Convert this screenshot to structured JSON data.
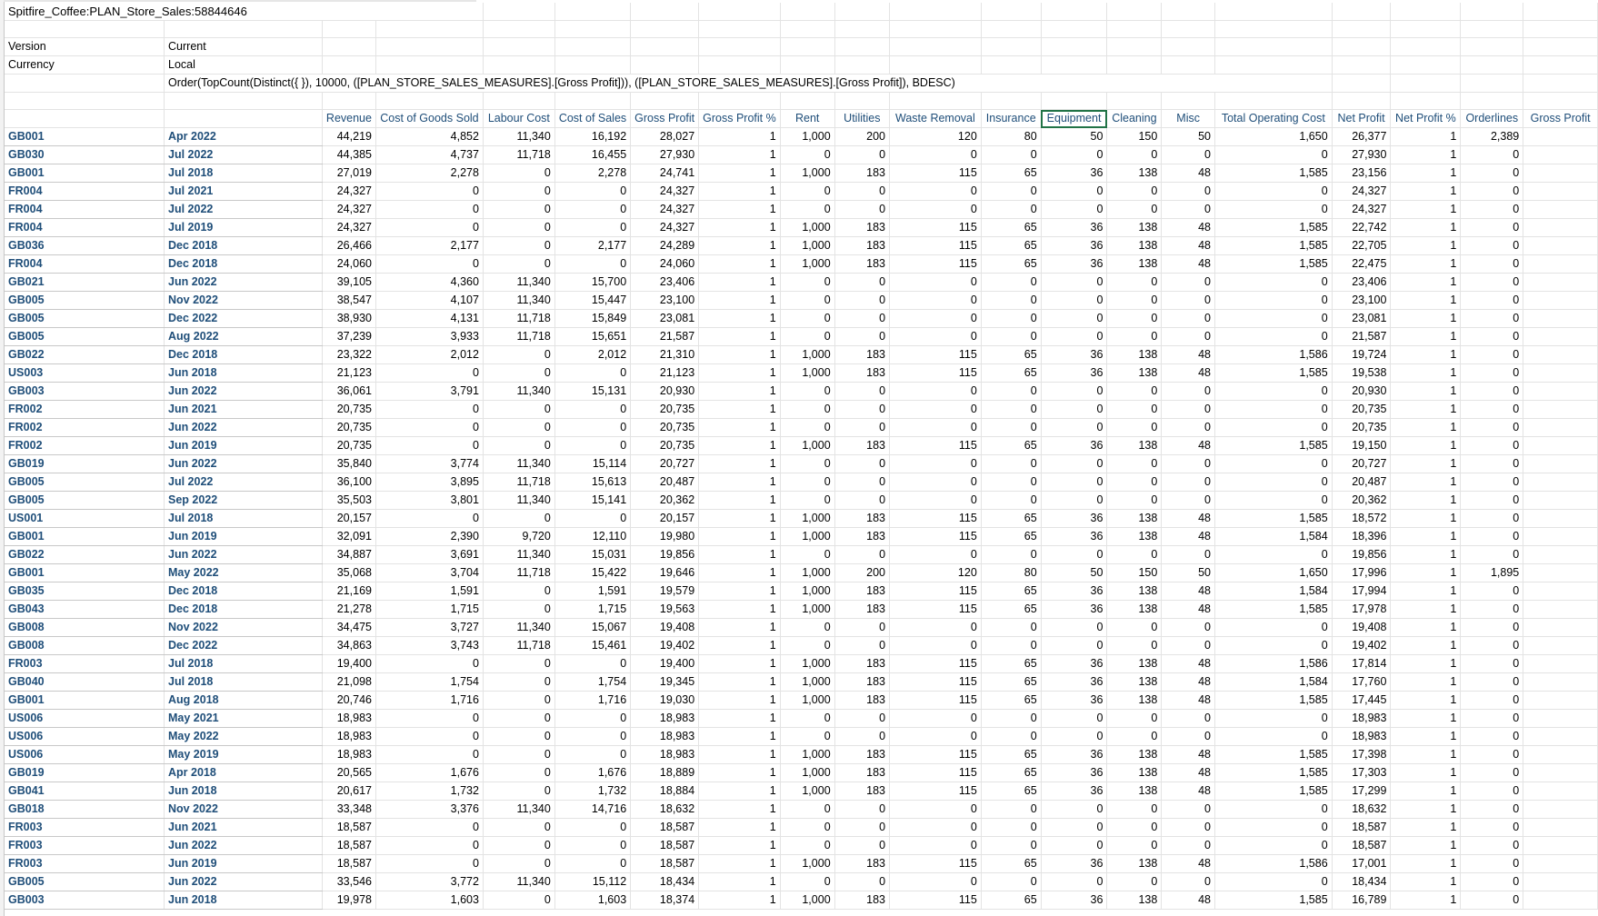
{
  "sheet": {
    "title": "Spitfire_Coffee:PLAN_Store_Sales:58844646",
    "version_label": "Version",
    "version_value": "Current",
    "currency_label": "Currency",
    "currency_value": "Local",
    "formula": "Order(TopCount(Distinct({  }), 10000, ([PLAN_STORE_SALES_MEASURES].[Gross Profit])), ([PLAN_STORE_SALES_MEASURES].[Gross Profit]), BDESC)"
  },
  "columns": [
    "Revenue",
    "Cost of Goods Sold",
    "Labour Cost",
    "Cost of Sales",
    "Gross Profit",
    "Gross Profit %",
    "Rent",
    "Utilities",
    "Waste Removal",
    "Insurance",
    "Equipment",
    "Cleaning",
    "Misc",
    "Total Operating Cost",
    "Net Profit",
    "Net Profit %",
    "Orderlines",
    "Gross Profit"
  ],
  "rows": [
    [
      "GB001",
      "Apr 2022",
      "44,219",
      "4,852",
      "11,340",
      "16,192",
      "28,027",
      "1",
      "1,000",
      "200",
      "120",
      "80",
      "50",
      "150",
      "50",
      "1,650",
      "26,377",
      "1",
      "2,389"
    ],
    [
      "GB030",
      "Jul 2022",
      "44,385",
      "4,737",
      "11,718",
      "16,455",
      "27,930",
      "1",
      "0",
      "0",
      "0",
      "0",
      "0",
      "0",
      "0",
      "0",
      "27,930",
      "1",
      "0"
    ],
    [
      "GB001",
      "Jul 2018",
      "27,019",
      "2,278",
      "0",
      "2,278",
      "24,741",
      "1",
      "1,000",
      "183",
      "115",
      "65",
      "36",
      "138",
      "48",
      "1,585",
      "23,156",
      "1",
      "0"
    ],
    [
      "FR004",
      "Jul 2021",
      "24,327",
      "0",
      "0",
      "0",
      "24,327",
      "1",
      "0",
      "0",
      "0",
      "0",
      "0",
      "0",
      "0",
      "0",
      "24,327",
      "1",
      "0"
    ],
    [
      "FR004",
      "Jul 2022",
      "24,327",
      "0",
      "0",
      "0",
      "24,327",
      "1",
      "0",
      "0",
      "0",
      "0",
      "0",
      "0",
      "0",
      "0",
      "24,327",
      "1",
      "0"
    ],
    [
      "FR004",
      "Jul 2019",
      "24,327",
      "0",
      "0",
      "0",
      "24,327",
      "1",
      "1,000",
      "183",
      "115",
      "65",
      "36",
      "138",
      "48",
      "1,585",
      "22,742",
      "1",
      "0"
    ],
    [
      "GB036",
      "Dec 2018",
      "26,466",
      "2,177",
      "0",
      "2,177",
      "24,289",
      "1",
      "1,000",
      "183",
      "115",
      "65",
      "36",
      "138",
      "48",
      "1,585",
      "22,705",
      "1",
      "0"
    ],
    [
      "FR004",
      "Dec 2018",
      "24,060",
      "0",
      "0",
      "0",
      "24,060",
      "1",
      "1,000",
      "183",
      "115",
      "65",
      "36",
      "138",
      "48",
      "1,585",
      "22,475",
      "1",
      "0"
    ],
    [
      "GB021",
      "Jun 2022",
      "39,105",
      "4,360",
      "11,340",
      "15,700",
      "23,406",
      "1",
      "0",
      "0",
      "0",
      "0",
      "0",
      "0",
      "0",
      "0",
      "23,406",
      "1",
      "0"
    ],
    [
      "GB005",
      "Nov 2022",
      "38,547",
      "4,107",
      "11,340",
      "15,447",
      "23,100",
      "1",
      "0",
      "0",
      "0",
      "0",
      "0",
      "0",
      "0",
      "0",
      "23,100",
      "1",
      "0"
    ],
    [
      "GB005",
      "Dec 2022",
      "38,930",
      "4,131",
      "11,718",
      "15,849",
      "23,081",
      "1",
      "0",
      "0",
      "0",
      "0",
      "0",
      "0",
      "0",
      "0",
      "23,081",
      "1",
      "0"
    ],
    [
      "GB005",
      "Aug 2022",
      "37,239",
      "3,933",
      "11,718",
      "15,651",
      "21,587",
      "1",
      "0",
      "0",
      "0",
      "0",
      "0",
      "0",
      "0",
      "0",
      "21,587",
      "1",
      "0"
    ],
    [
      "GB022",
      "Dec 2018",
      "23,322",
      "2,012",
      "0",
      "2,012",
      "21,310",
      "1",
      "1,000",
      "183",
      "115",
      "65",
      "36",
      "138",
      "48",
      "1,586",
      "19,724",
      "1",
      "0"
    ],
    [
      "US003",
      "Jun 2018",
      "21,123",
      "0",
      "0",
      "0",
      "21,123",
      "1",
      "1,000",
      "183",
      "115",
      "65",
      "36",
      "138",
      "48",
      "1,585",
      "19,538",
      "1",
      "0"
    ],
    [
      "GB003",
      "Jun 2022",
      "36,061",
      "3,791",
      "11,340",
      "15,131",
      "20,930",
      "1",
      "0",
      "0",
      "0",
      "0",
      "0",
      "0",
      "0",
      "0",
      "20,930",
      "1",
      "0"
    ],
    [
      "FR002",
      "Jun 2021",
      "20,735",
      "0",
      "0",
      "0",
      "20,735",
      "1",
      "0",
      "0",
      "0",
      "0",
      "0",
      "0",
      "0",
      "0",
      "20,735",
      "1",
      "0"
    ],
    [
      "FR002",
      "Jun 2022",
      "20,735",
      "0",
      "0",
      "0",
      "20,735",
      "1",
      "0",
      "0",
      "0",
      "0",
      "0",
      "0",
      "0",
      "0",
      "20,735",
      "1",
      "0"
    ],
    [
      "FR002",
      "Jun 2019",
      "20,735",
      "0",
      "0",
      "0",
      "20,735",
      "1",
      "1,000",
      "183",
      "115",
      "65",
      "36",
      "138",
      "48",
      "1,585",
      "19,150",
      "1",
      "0"
    ],
    [
      "GB019",
      "Jun 2022",
      "35,840",
      "3,774",
      "11,340",
      "15,114",
      "20,727",
      "1",
      "0",
      "0",
      "0",
      "0",
      "0",
      "0",
      "0",
      "0",
      "20,727",
      "1",
      "0"
    ],
    [
      "GB005",
      "Jul 2022",
      "36,100",
      "3,895",
      "11,718",
      "15,613",
      "20,487",
      "1",
      "0",
      "0",
      "0",
      "0",
      "0",
      "0",
      "0",
      "0",
      "20,487",
      "1",
      "0"
    ],
    [
      "GB005",
      "Sep 2022",
      "35,503",
      "3,801",
      "11,340",
      "15,141",
      "20,362",
      "1",
      "0",
      "0",
      "0",
      "0",
      "0",
      "0",
      "0",
      "0",
      "20,362",
      "1",
      "0"
    ],
    [
      "US001",
      "Jul 2018",
      "20,157",
      "0",
      "0",
      "0",
      "20,157",
      "1",
      "1,000",
      "183",
      "115",
      "65",
      "36",
      "138",
      "48",
      "1,585",
      "18,572",
      "1",
      "0"
    ],
    [
      "GB001",
      "Jun 2019",
      "32,091",
      "2,390",
      "9,720",
      "12,110",
      "19,980",
      "1",
      "1,000",
      "183",
      "115",
      "65",
      "36",
      "138",
      "48",
      "1,584",
      "18,396",
      "1",
      "0"
    ],
    [
      "GB022",
      "Jun 2022",
      "34,887",
      "3,691",
      "11,340",
      "15,031",
      "19,856",
      "1",
      "0",
      "0",
      "0",
      "0",
      "0",
      "0",
      "0",
      "0",
      "19,856",
      "1",
      "0"
    ],
    [
      "GB001",
      "May 2022",
      "35,068",
      "3,704",
      "11,718",
      "15,422",
      "19,646",
      "1",
      "1,000",
      "200",
      "120",
      "80",
      "50",
      "150",
      "50",
      "1,650",
      "17,996",
      "1",
      "1,895"
    ],
    [
      "GB035",
      "Dec 2018",
      "21,169",
      "1,591",
      "0",
      "1,591",
      "19,579",
      "1",
      "1,000",
      "183",
      "115",
      "65",
      "36",
      "138",
      "48",
      "1,584",
      "17,994",
      "1",
      "0"
    ],
    [
      "GB043",
      "Dec 2018",
      "21,278",
      "1,715",
      "0",
      "1,715",
      "19,563",
      "1",
      "1,000",
      "183",
      "115",
      "65",
      "36",
      "138",
      "48",
      "1,585",
      "17,978",
      "1",
      "0"
    ],
    [
      "GB008",
      "Nov 2022",
      "34,475",
      "3,727",
      "11,340",
      "15,067",
      "19,408",
      "1",
      "0",
      "0",
      "0",
      "0",
      "0",
      "0",
      "0",
      "0",
      "19,408",
      "1",
      "0"
    ],
    [
      "GB008",
      "Dec 2022",
      "34,863",
      "3,743",
      "11,718",
      "15,461",
      "19,402",
      "1",
      "0",
      "0",
      "0",
      "0",
      "0",
      "0",
      "0",
      "0",
      "19,402",
      "1",
      "0"
    ],
    [
      "FR003",
      "Jul 2018",
      "19,400",
      "0",
      "0",
      "0",
      "19,400",
      "1",
      "1,000",
      "183",
      "115",
      "65",
      "36",
      "138",
      "48",
      "1,586",
      "17,814",
      "1",
      "0"
    ],
    [
      "GB040",
      "Jul 2018",
      "21,098",
      "1,754",
      "0",
      "1,754",
      "19,345",
      "1",
      "1,000",
      "183",
      "115",
      "65",
      "36",
      "138",
      "48",
      "1,584",
      "17,760",
      "1",
      "0"
    ],
    [
      "GB001",
      "Aug 2018",
      "20,746",
      "1,716",
      "0",
      "1,716",
      "19,030",
      "1",
      "1,000",
      "183",
      "115",
      "65",
      "36",
      "138",
      "48",
      "1,585",
      "17,445",
      "1",
      "0"
    ],
    [
      "US006",
      "May 2021",
      "18,983",
      "0",
      "0",
      "0",
      "18,983",
      "1",
      "0",
      "0",
      "0",
      "0",
      "0",
      "0",
      "0",
      "0",
      "18,983",
      "1",
      "0"
    ],
    [
      "US006",
      "May 2022",
      "18,983",
      "0",
      "0",
      "0",
      "18,983",
      "1",
      "0",
      "0",
      "0",
      "0",
      "0",
      "0",
      "0",
      "0",
      "18,983",
      "1",
      "0"
    ],
    [
      "US006",
      "May 2019",
      "18,983",
      "0",
      "0",
      "0",
      "18,983",
      "1",
      "1,000",
      "183",
      "115",
      "65",
      "36",
      "138",
      "48",
      "1,585",
      "17,398",
      "1",
      "0"
    ],
    [
      "GB019",
      "Apr 2018",
      "20,565",
      "1,676",
      "0",
      "1,676",
      "18,889",
      "1",
      "1,000",
      "183",
      "115",
      "65",
      "36",
      "138",
      "48",
      "1,585",
      "17,303",
      "1",
      "0"
    ],
    [
      "GB041",
      "Jun 2018",
      "20,617",
      "1,732",
      "0",
      "1,732",
      "18,884",
      "1",
      "1,000",
      "183",
      "115",
      "65",
      "36",
      "138",
      "48",
      "1,585",
      "17,299",
      "1",
      "0"
    ],
    [
      "GB018",
      "Nov 2022",
      "33,348",
      "3,376",
      "11,340",
      "14,716",
      "18,632",
      "1",
      "0",
      "0",
      "0",
      "0",
      "0",
      "0",
      "0",
      "0",
      "18,632",
      "1",
      "0"
    ],
    [
      "FR003",
      "Jun 2021",
      "18,587",
      "0",
      "0",
      "0",
      "18,587",
      "1",
      "0",
      "0",
      "0",
      "0",
      "0",
      "0",
      "0",
      "0",
      "18,587",
      "1",
      "0"
    ],
    [
      "FR003",
      "Jun 2022",
      "18,587",
      "0",
      "0",
      "0",
      "18,587",
      "1",
      "0",
      "0",
      "0",
      "0",
      "0",
      "0",
      "0",
      "0",
      "18,587",
      "1",
      "0"
    ],
    [
      "FR003",
      "Jun 2019",
      "18,587",
      "0",
      "0",
      "0",
      "18,587",
      "1",
      "1,000",
      "183",
      "115",
      "65",
      "36",
      "138",
      "48",
      "1,586",
      "17,001",
      "1",
      "0"
    ],
    [
      "GB005",
      "Jun 2022",
      "33,546",
      "3,772",
      "11,340",
      "15,112",
      "18,434",
      "1",
      "0",
      "0",
      "0",
      "0",
      "0",
      "0",
      "0",
      "0",
      "18,434",
      "1",
      "0"
    ],
    [
      "GB003",
      "Jun 2018",
      "19,978",
      "1,603",
      "0",
      "1,603",
      "18,374",
      "1",
      "1,000",
      "183",
      "115",
      "65",
      "36",
      "138",
      "48",
      "1,585",
      "16,789",
      "1",
      "0"
    ]
  ]
}
